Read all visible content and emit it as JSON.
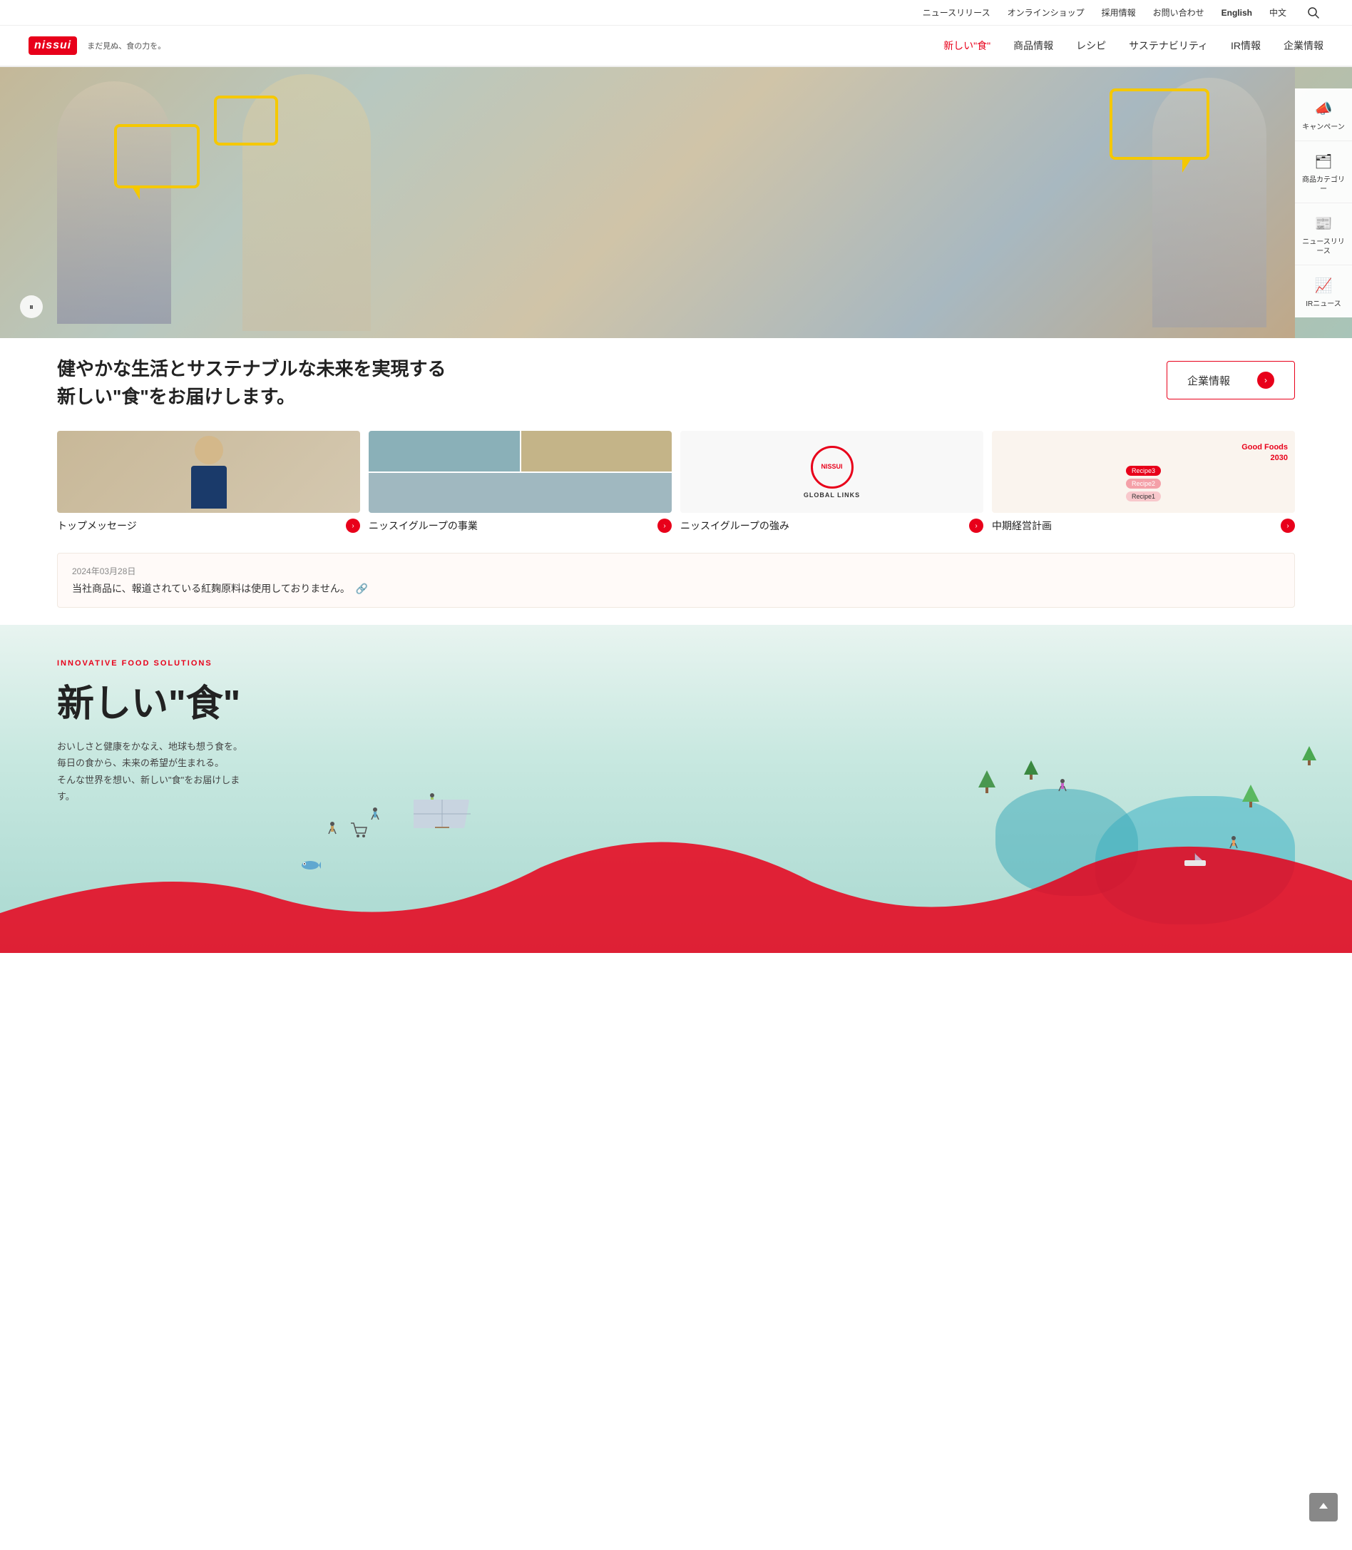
{
  "topbar": {
    "links": [
      "ニュースリリース",
      "オンラインショップ",
      "採用情報",
      "お問い合わせ",
      "English",
      "中文"
    ],
    "lang_en": "English",
    "lang_zh": "中文"
  },
  "logo": {
    "brand": "nissui",
    "tagline": "まだ見ぬ、食の力を。"
  },
  "nav": {
    "items": [
      "新しい\"食\"",
      "商品情報",
      "レシピ",
      "サステナビリティ",
      "IR情報",
      "企業情報"
    ]
  },
  "sidebar": {
    "items": [
      {
        "label": "キャンペーン",
        "icon": "📣"
      },
      {
        "label": "商品カテゴリー",
        "icon": "🗂"
      },
      {
        "label": "ニュースリリース",
        "icon": "📰"
      },
      {
        "label": "IRニュース",
        "icon": "📈"
      }
    ]
  },
  "hero": {
    "pause_label": "⏸",
    "caption_line1": "健やかな生活とサステナブルな未来を実現する",
    "caption_line2": "新しい\"食\"をお届けします。",
    "cta_label": "企業情報"
  },
  "cards": [
    {
      "label": "トップメッセージ",
      "type": "top-message"
    },
    {
      "label": "ニッスイグループの事業",
      "type": "industrial"
    },
    {
      "label": "ニッスイグループの強み",
      "type": "global",
      "global_text": "NISSUI",
      "global_sub": "GLOBAL LINKS"
    },
    {
      "label": "中期経営計画",
      "type": "midterm",
      "title_line1": "Good Foods",
      "title_line2": "2030",
      "bubbles": [
        "Recipe3",
        "Recipe2",
        "Recipe1"
      ]
    }
  ],
  "news": {
    "date": "2024年03月28日",
    "text": "当社商品に、報道されている紅麹原料は使用しておりません。"
  },
  "innovative": {
    "label": "INNOVATIVE FOOD SOLUTIONS",
    "title": "新しい\"食\"",
    "desc_lines": [
      "おいしさと健康をかなえ、地球も想う食を。",
      "毎日の食から、未来の希望が生まれる。",
      "そんな世界を想い、新しい\"食\"をお届けします。"
    ]
  },
  "colors": {
    "brand_red": "#e8001a",
    "yellow_accent": "#f5c800",
    "teal": "#4ab8c8",
    "light_bg": "#faf4ee"
  }
}
